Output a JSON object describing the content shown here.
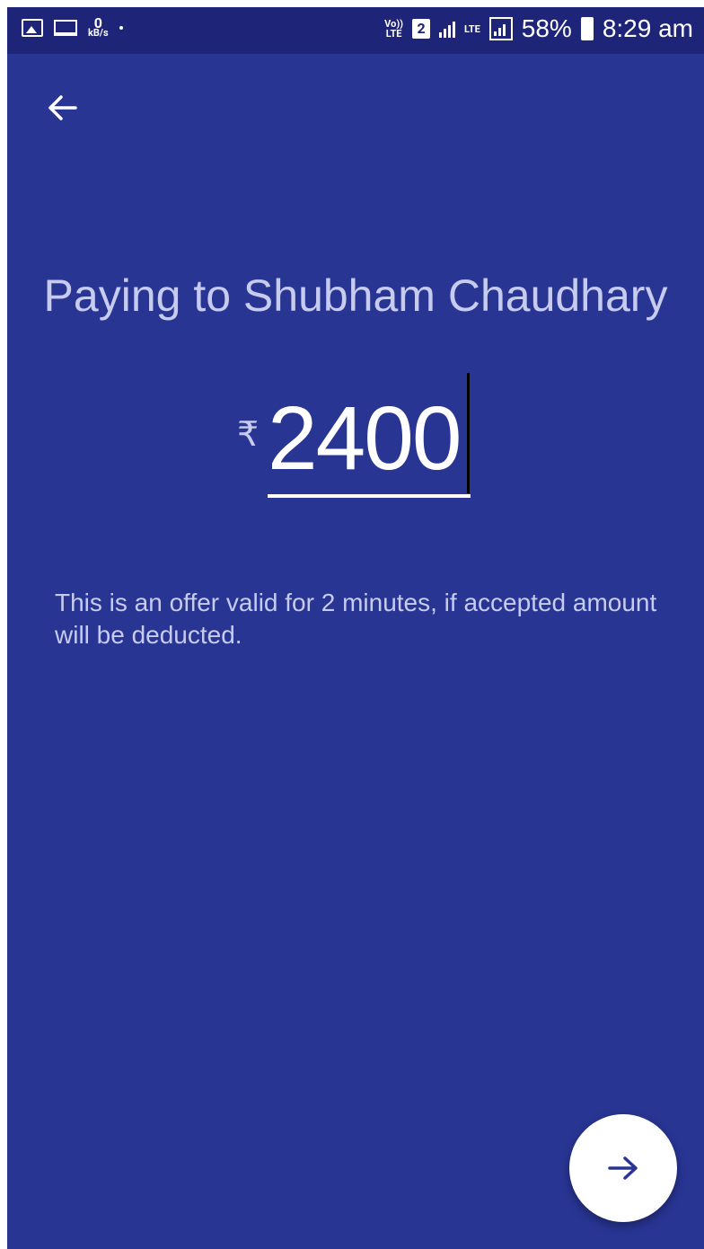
{
  "status_bar": {
    "speed_value": "0",
    "speed_unit": "kB/s",
    "volte_line1": "Vo))",
    "volte_line2": "LTE",
    "sim_number": "2",
    "lte_label": "LTE",
    "battery_percent": "58%",
    "time": "8:29 am"
  },
  "header": {
    "title": "Paying to Shubham Chaudhary"
  },
  "payment": {
    "currency_symbol": "₹",
    "amount": "2400"
  },
  "notice": {
    "text": "This is an offer valid for 2 minutes, if accepted amount will be deducted."
  },
  "colors": {
    "background": "#283593",
    "status_bar": "#1e2478",
    "text_muted": "#c7cbee",
    "fab": "#ffffff",
    "accent": "#283593"
  },
  "icons": {
    "back": "arrow-left-icon",
    "next": "arrow-right-icon"
  }
}
